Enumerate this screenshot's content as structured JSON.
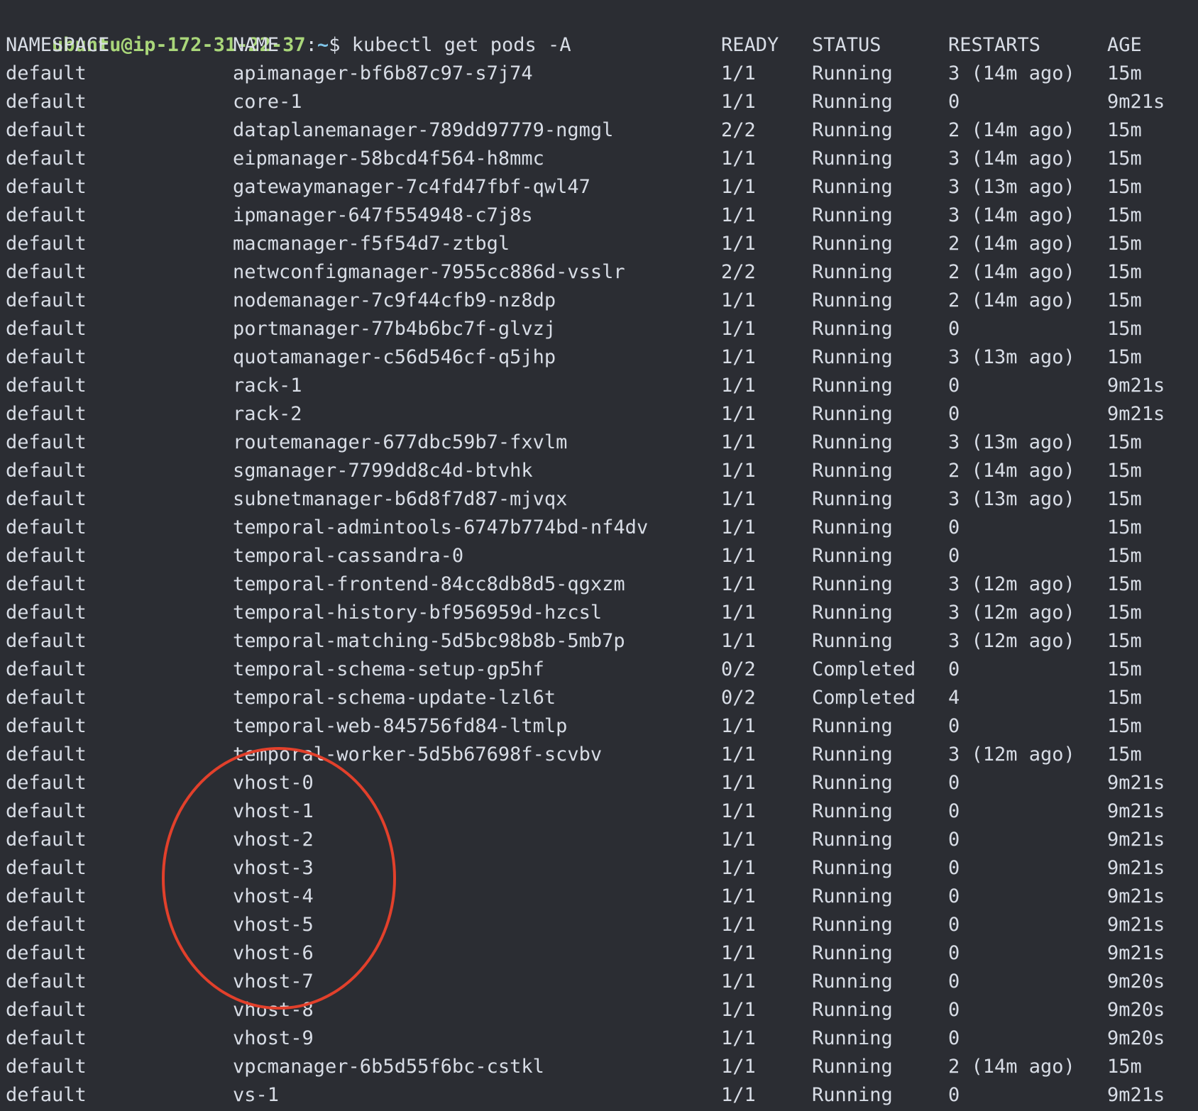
{
  "prompt": {
    "user_host": "ubuntu@ip-172-31-22-37",
    "separator": ":",
    "path": "~",
    "symbol": "$",
    "command": "kubectl get pods -A"
  },
  "table": {
    "headers": [
      "NAMESPACE",
      "NAME",
      "READY",
      "STATUS",
      "RESTARTS",
      "AGE"
    ],
    "rows": [
      [
        "default",
        "apimanager-bf6b87c97-s7j74",
        "1/1",
        "Running",
        "3 (14m ago)",
        "15m"
      ],
      [
        "default",
        "core-1",
        "1/1",
        "Running",
        "0",
        "9m21s"
      ],
      [
        "default",
        "dataplanemanager-789dd97779-ngmgl",
        "2/2",
        "Running",
        "2 (14m ago)",
        "15m"
      ],
      [
        "default",
        "eipmanager-58bcd4f564-h8mmc",
        "1/1",
        "Running",
        "3 (14m ago)",
        "15m"
      ],
      [
        "default",
        "gatewaymanager-7c4fd47fbf-qwl47",
        "1/1",
        "Running",
        "3 (13m ago)",
        "15m"
      ],
      [
        "default",
        "ipmanager-647f554948-c7j8s",
        "1/1",
        "Running",
        "3 (14m ago)",
        "15m"
      ],
      [
        "default",
        "macmanager-f5f54d7-ztbgl",
        "1/1",
        "Running",
        "2 (14m ago)",
        "15m"
      ],
      [
        "default",
        "netwconfigmanager-7955cc886d-vsslr",
        "2/2",
        "Running",
        "2 (14m ago)",
        "15m"
      ],
      [
        "default",
        "nodemanager-7c9f44cfb9-nz8dp",
        "1/1",
        "Running",
        "2 (14m ago)",
        "15m"
      ],
      [
        "default",
        "portmanager-77b4b6bc7f-glvzj",
        "1/1",
        "Running",
        "0",
        "15m"
      ],
      [
        "default",
        "quotamanager-c56d546cf-q5jhp",
        "1/1",
        "Running",
        "3 (13m ago)",
        "15m"
      ],
      [
        "default",
        "rack-1",
        "1/1",
        "Running",
        "0",
        "9m21s"
      ],
      [
        "default",
        "rack-2",
        "1/1",
        "Running",
        "0",
        "9m21s"
      ],
      [
        "default",
        "routemanager-677dbc59b7-fxvlm",
        "1/1",
        "Running",
        "3 (13m ago)",
        "15m"
      ],
      [
        "default",
        "sgmanager-7799dd8c4d-btvhk",
        "1/1",
        "Running",
        "2 (14m ago)",
        "15m"
      ],
      [
        "default",
        "subnetmanager-b6d8f7d87-mjvqx",
        "1/1",
        "Running",
        "3 (13m ago)",
        "15m"
      ],
      [
        "default",
        "temporal-admintools-6747b774bd-nf4dv",
        "1/1",
        "Running",
        "0",
        "15m"
      ],
      [
        "default",
        "temporal-cassandra-0",
        "1/1",
        "Running",
        "0",
        "15m"
      ],
      [
        "default",
        "temporal-frontend-84cc8db8d5-qgxzm",
        "1/1",
        "Running",
        "3 (12m ago)",
        "15m"
      ],
      [
        "default",
        "temporal-history-bf956959d-hzcsl",
        "1/1",
        "Running",
        "3 (12m ago)",
        "15m"
      ],
      [
        "default",
        "temporal-matching-5d5bc98b8b-5mb7p",
        "1/1",
        "Running",
        "3 (12m ago)",
        "15m"
      ],
      [
        "default",
        "temporal-schema-setup-gp5hf",
        "0/2",
        "Completed",
        "0",
        "15m"
      ],
      [
        "default",
        "temporal-schema-update-lzl6t",
        "0/2",
        "Completed",
        "4",
        "15m"
      ],
      [
        "default",
        "temporal-web-845756fd84-ltmlp",
        "1/1",
        "Running",
        "0",
        "15m"
      ],
      [
        "default",
        "temporal-worker-5d5b67698f-scvbv",
        "1/1",
        "Running",
        "3 (12m ago)",
        "15m"
      ],
      [
        "default",
        "vhost-0",
        "1/1",
        "Running",
        "0",
        "9m21s"
      ],
      [
        "default",
        "vhost-1",
        "1/1",
        "Running",
        "0",
        "9m21s"
      ],
      [
        "default",
        "vhost-2",
        "1/1",
        "Running",
        "0",
        "9m21s"
      ],
      [
        "default",
        "vhost-3",
        "1/1",
        "Running",
        "0",
        "9m21s"
      ],
      [
        "default",
        "vhost-4",
        "1/1",
        "Running",
        "0",
        "9m21s"
      ],
      [
        "default",
        "vhost-5",
        "1/1",
        "Running",
        "0",
        "9m21s"
      ],
      [
        "default",
        "vhost-6",
        "1/1",
        "Running",
        "0",
        "9m21s"
      ],
      [
        "default",
        "vhost-7",
        "1/1",
        "Running",
        "0",
        "9m20s"
      ],
      [
        "default",
        "vhost-8",
        "1/1",
        "Running",
        "0",
        "9m20s"
      ],
      [
        "default",
        "vhost-9",
        "1/1",
        "Running",
        "0",
        "9m20s"
      ],
      [
        "default",
        "vpcmanager-6b5d55f6bc-cstkl",
        "1/1",
        "Running",
        "2 (14m ago)",
        "15m"
      ],
      [
        "default",
        "vs-1",
        "1/1",
        "Running",
        "0",
        "9m21s"
      ]
    ]
  },
  "colors": {
    "background": "#2b2d33",
    "text": "#d8dde6",
    "prompt_user": "#a9d67a",
    "prompt_path": "#7fc4e8",
    "annotation": "#e2402b"
  }
}
